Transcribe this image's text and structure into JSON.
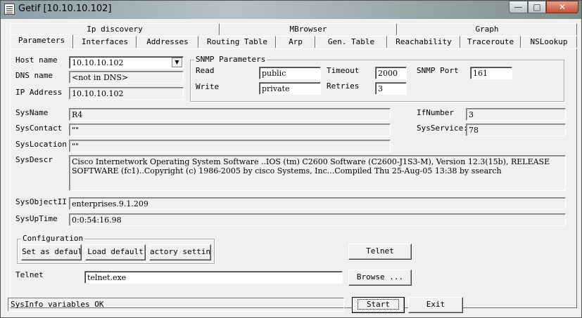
{
  "window": {
    "title": "Getif [10.10.10.102]"
  },
  "tabs_row1": [
    "Ip discovery",
    "MBrowser",
    "Graph"
  ],
  "tabs_row2": [
    "Parameters",
    "Interfaces",
    "Addresses",
    "Routing Table",
    "Arp",
    "Gen. Table",
    "Reachability",
    "Traceroute",
    "NSLookup"
  ],
  "host": {
    "host_name_label": "Host name",
    "host_name_value": "10.10.10.102",
    "dns_label": "DNS name",
    "dns_value": "<not in DNS>",
    "ip_label": "IP Address",
    "ip_value": "10.10.10.102"
  },
  "snmp": {
    "title": "SNMP Parameters",
    "read_label": "Read",
    "read_value": "public",
    "write_label": "Write",
    "write_value": "private",
    "timeout_label": "Timeout",
    "timeout_value": "2000",
    "retries_label": "Retries",
    "retries_value": "3",
    "port_label": "SNMP Port",
    "port_value": "161"
  },
  "sys": {
    "name_label": "SysName",
    "name_value": "R4",
    "contact_label": "SysContact",
    "contact_value": "\"\"",
    "location_label": "SysLocation",
    "location_value": "\"\"",
    "descr_label": "SysDescr",
    "descr_value": "Cisco Internetwork Operating System Software ..IOS (tm) C2600 Software (C2600-J1S3-M), Version 12.3(15b), RELEASE SOFTWARE (fc1)..Copyright (c) 1986-2005 by cisco Systems, Inc...Compiled Thu 25-Aug-05 13:38 by ssearch",
    "objectid_label": "SysObjectII",
    "objectid_value": "enterprises.9.1.209",
    "uptime_label": "SysUpTime",
    "uptime_value": "0:0:54:16.98",
    "ifnumber_label": "IfNumber",
    "ifnumber_value": "3",
    "services_label": "SysService:",
    "services_value": "78"
  },
  "config": {
    "title": "Configuration",
    "set_default": "Set as default",
    "load_default": "Load default",
    "factory": "actory setting"
  },
  "telnet": {
    "button": "Telnet",
    "label": "Telnet",
    "path_value": "telnet.exe",
    "browse": "Browse ..."
  },
  "status": {
    "text": "SysInfo variables OK"
  },
  "actions": {
    "start": "Start",
    "exit": "Exit"
  }
}
